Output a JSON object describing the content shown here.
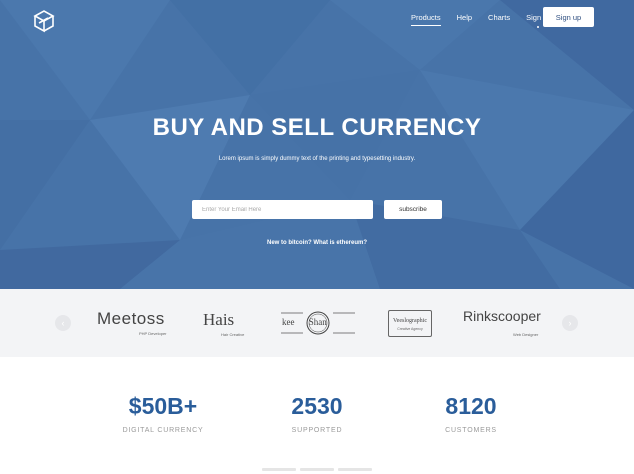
{
  "nav": {
    "items": [
      {
        "label": "Products"
      },
      {
        "label": "Help"
      },
      {
        "label": "Charts"
      },
      {
        "label": "Sign in"
      }
    ],
    "signup_label": "Sign up"
  },
  "hero": {
    "title": "BUY AND SELL CURRENCY",
    "subtitle": "Lorem ipsum is simply dummy text of the printing and typesetting industry.",
    "email_placeholder": "Enter Your Email Here",
    "subscribe_label": "subscribe",
    "link_text": "New to bitcoin? What is ethereum?"
  },
  "brands": [
    {
      "name": "Meetoss",
      "tagline": "PHP Developer"
    },
    {
      "name": "Hais",
      "tagline": "Hair Creative"
    },
    {
      "name": "kee Shan",
      "tagline": ""
    },
    {
      "name": "Veeslographic",
      "tagline": "Creative Agency"
    },
    {
      "name": "Rinkscooper",
      "tagline": "Web Designer"
    }
  ],
  "stats": [
    {
      "value": "$50B+",
      "label": "DIGITAL CURRENCY"
    },
    {
      "value": "2530",
      "label": "SUPPORTED"
    },
    {
      "value": "8120",
      "label": "CUSTOMERS"
    }
  ],
  "colors": {
    "hero_bg": "#4773a8",
    "stat_color": "#2a5d9a",
    "strip_bg": "#f3f4f6"
  }
}
